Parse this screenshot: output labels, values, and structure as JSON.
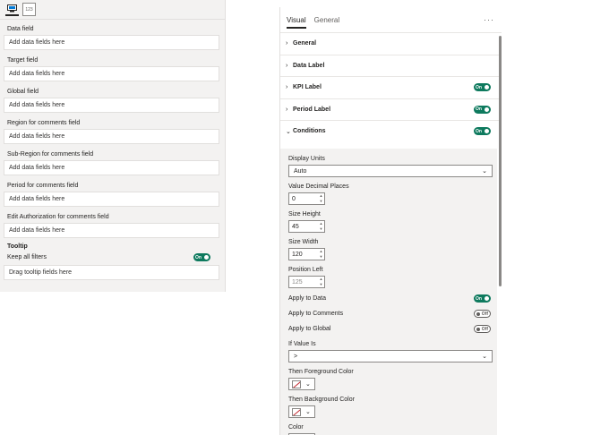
{
  "left_pane": {
    "toolbar": {
      "format_icon_label": "",
      "fields_icon_label": "123"
    },
    "wells": [
      {
        "label": "Data field",
        "placeholder": "Add data fields here"
      },
      {
        "label": "Target field",
        "placeholder": "Add data fields here"
      },
      {
        "label": "Global field",
        "placeholder": "Add data fields here"
      },
      {
        "label": "Region for comments field",
        "placeholder": "Add data fields here"
      },
      {
        "label": "Sub-Region for comments field",
        "placeholder": "Add data fields here"
      },
      {
        "label": "Period for comments field",
        "placeholder": "Add data fields here"
      },
      {
        "label": "Edit Authorization for comments field",
        "placeholder": "Add data fields here"
      }
    ],
    "tooltip": {
      "title": "Tooltip",
      "keep_filters_label": "Keep all filters",
      "keep_filters_toggle": "On",
      "drag_placeholder": "Drag tooltip fields here"
    }
  },
  "right_pane": {
    "tabs": {
      "visual": "Visual",
      "general": "General"
    },
    "more": "···",
    "sections": [
      {
        "label": "General",
        "toggle": null,
        "expanded": false
      },
      {
        "label": "Data Label",
        "toggle": null,
        "expanded": false
      },
      {
        "label": "KPI Label",
        "toggle": "On",
        "expanded": false
      },
      {
        "label": "Period Label",
        "toggle": "On",
        "expanded": false
      },
      {
        "label": "Conditions",
        "toggle": "On",
        "expanded": true
      }
    ],
    "conditions": {
      "display_units_label": "Display Units",
      "display_units_value": "Auto",
      "decimal_label": "Value Decimal Places",
      "decimal_value": "0",
      "size_height_label": "Size Height",
      "size_height_value": "45",
      "size_width_label": "Size Width",
      "size_width_value": "120",
      "position_left_label": "Position Left",
      "position_left_value": "125",
      "apply_data_label": "Apply to Data",
      "apply_data_toggle": "On",
      "apply_comments_label": "Apply to Comments",
      "apply_comments_toggle": "Off",
      "apply_global_label": "Apply to Global",
      "apply_global_toggle": "Off",
      "if_value_label": "If Value Is",
      "if_value_value": ">",
      "fg_color_label": "Then Foreground Color",
      "bg_color_label": "Then Background Color",
      "color_label": "Color"
    }
  },
  "colors": {
    "toggle_on": "#0e7a5e",
    "pane_bg": "#f3f2f1",
    "swatch_black": "#000000",
    "swatch_none_slash": "#c4262e"
  }
}
